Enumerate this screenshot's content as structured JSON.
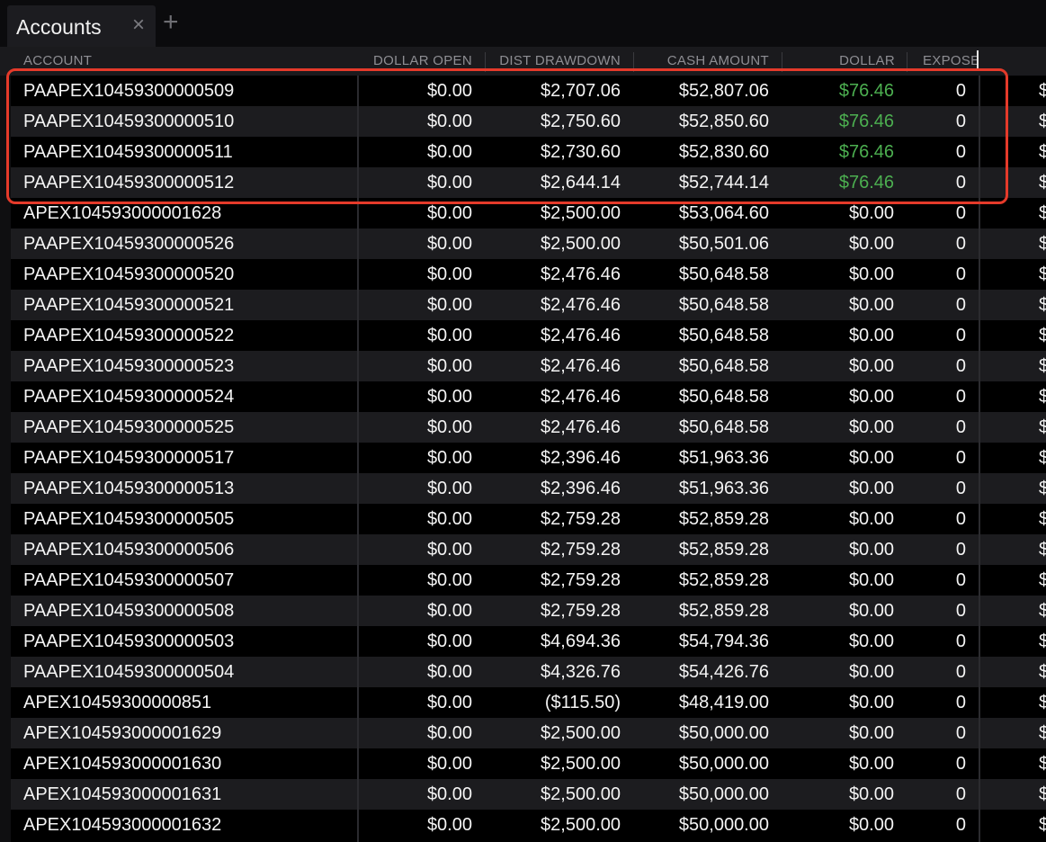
{
  "tab": {
    "title": "Accounts",
    "close": "×",
    "add": "+"
  },
  "columns": [
    "ACCOUNT",
    "DOLLAR OPEN",
    "DIST DRAWDOWN",
    "CASH AMOUNT",
    "DOLLAR",
    "EXPOSE"
  ],
  "rows": [
    {
      "account": "PAAPEX10459300000509",
      "dollar_open": "$0.00",
      "dist_drawdown": "$2,707.06",
      "cash_amount": "$52,807.06",
      "dollar": "$76.46",
      "expose": "0",
      "trail": "$",
      "dollar_status": "positive"
    },
    {
      "account": "PAAPEX10459300000510",
      "dollar_open": "$0.00",
      "dist_drawdown": "$2,750.60",
      "cash_amount": "$52,850.60",
      "dollar": "$76.46",
      "expose": "0",
      "trail": "$",
      "dollar_status": "positive"
    },
    {
      "account": "PAAPEX10459300000511",
      "dollar_open": "$0.00",
      "dist_drawdown": "$2,730.60",
      "cash_amount": "$52,830.60",
      "dollar": "$76.46",
      "expose": "0",
      "trail": "$",
      "dollar_status": "positive"
    },
    {
      "account": "PAAPEX10459300000512",
      "dollar_open": "$0.00",
      "dist_drawdown": "$2,644.14",
      "cash_amount": "$52,744.14",
      "dollar": "$76.46",
      "expose": "0",
      "trail": "$",
      "dollar_status": "positive"
    },
    {
      "account": "APEX104593000001628",
      "dollar_open": "$0.00",
      "dist_drawdown": "$2,500.00",
      "cash_amount": "$53,064.60",
      "dollar": "$0.00",
      "expose": "0",
      "trail": "$",
      "dollar_status": "neutral"
    },
    {
      "account": "PAAPEX10459300000526",
      "dollar_open": "$0.00",
      "dist_drawdown": "$2,500.00",
      "cash_amount": "$50,501.06",
      "dollar": "$0.00",
      "expose": "0",
      "trail": "$",
      "dollar_status": "neutral"
    },
    {
      "account": "PAAPEX10459300000520",
      "dollar_open": "$0.00",
      "dist_drawdown": "$2,476.46",
      "cash_amount": "$50,648.58",
      "dollar": "$0.00",
      "expose": "0",
      "trail": "$",
      "dollar_status": "neutral"
    },
    {
      "account": "PAAPEX10459300000521",
      "dollar_open": "$0.00",
      "dist_drawdown": "$2,476.46",
      "cash_amount": "$50,648.58",
      "dollar": "$0.00",
      "expose": "0",
      "trail": "$",
      "dollar_status": "neutral"
    },
    {
      "account": "PAAPEX10459300000522",
      "dollar_open": "$0.00",
      "dist_drawdown": "$2,476.46",
      "cash_amount": "$50,648.58",
      "dollar": "$0.00",
      "expose": "0",
      "trail": "$",
      "dollar_status": "neutral"
    },
    {
      "account": "PAAPEX10459300000523",
      "dollar_open": "$0.00",
      "dist_drawdown": "$2,476.46",
      "cash_amount": "$50,648.58",
      "dollar": "$0.00",
      "expose": "0",
      "trail": "$",
      "dollar_status": "neutral"
    },
    {
      "account": "PAAPEX10459300000524",
      "dollar_open": "$0.00",
      "dist_drawdown": "$2,476.46",
      "cash_amount": "$50,648.58",
      "dollar": "$0.00",
      "expose": "0",
      "trail": "$",
      "dollar_status": "neutral"
    },
    {
      "account": "PAAPEX10459300000525",
      "dollar_open": "$0.00",
      "dist_drawdown": "$2,476.46",
      "cash_amount": "$50,648.58",
      "dollar": "$0.00",
      "expose": "0",
      "trail": "$",
      "dollar_status": "neutral"
    },
    {
      "account": "PAAPEX10459300000517",
      "dollar_open": "$0.00",
      "dist_drawdown": "$2,396.46",
      "cash_amount": "$51,963.36",
      "dollar": "$0.00",
      "expose": "0",
      "trail": "$",
      "dollar_status": "neutral"
    },
    {
      "account": "PAAPEX10459300000513",
      "dollar_open": "$0.00",
      "dist_drawdown": "$2,396.46",
      "cash_amount": "$51,963.36",
      "dollar": "$0.00",
      "expose": "0",
      "trail": "$",
      "dollar_status": "neutral"
    },
    {
      "account": "PAAPEX10459300000505",
      "dollar_open": "$0.00",
      "dist_drawdown": "$2,759.28",
      "cash_amount": "$52,859.28",
      "dollar": "$0.00",
      "expose": "0",
      "trail": "$",
      "dollar_status": "neutral"
    },
    {
      "account": "PAAPEX10459300000506",
      "dollar_open": "$0.00",
      "dist_drawdown": "$2,759.28",
      "cash_amount": "$52,859.28",
      "dollar": "$0.00",
      "expose": "0",
      "trail": "$",
      "dollar_status": "neutral"
    },
    {
      "account": "PAAPEX10459300000507",
      "dollar_open": "$0.00",
      "dist_drawdown": "$2,759.28",
      "cash_amount": "$52,859.28",
      "dollar": "$0.00",
      "expose": "0",
      "trail": "$",
      "dollar_status": "neutral"
    },
    {
      "account": "PAAPEX10459300000508",
      "dollar_open": "$0.00",
      "dist_drawdown": "$2,759.28",
      "cash_amount": "$52,859.28",
      "dollar": "$0.00",
      "expose": "0",
      "trail": "$",
      "dollar_status": "neutral"
    },
    {
      "account": "PAAPEX10459300000503",
      "dollar_open": "$0.00",
      "dist_drawdown": "$4,694.36",
      "cash_amount": "$54,794.36",
      "dollar": "$0.00",
      "expose": "0",
      "trail": "$",
      "dollar_status": "neutral"
    },
    {
      "account": "PAAPEX10459300000504",
      "dollar_open": "$0.00",
      "dist_drawdown": "$4,326.76",
      "cash_amount": "$54,426.76",
      "dollar": "$0.00",
      "expose": "0",
      "trail": "$",
      "dollar_status": "neutral"
    },
    {
      "account": "APEX10459300000851",
      "dollar_open": "$0.00",
      "dist_drawdown": "($115.50)",
      "cash_amount": "$48,419.00",
      "dollar": "$0.00",
      "expose": "0",
      "trail": "$",
      "dollar_status": "neutral"
    },
    {
      "account": "APEX104593000001629",
      "dollar_open": "$0.00",
      "dist_drawdown": "$2,500.00",
      "cash_amount": "$50,000.00",
      "dollar": "$0.00",
      "expose": "0",
      "trail": "$",
      "dollar_status": "neutral"
    },
    {
      "account": "APEX104593000001630",
      "dollar_open": "$0.00",
      "dist_drawdown": "$2,500.00",
      "cash_amount": "$50,000.00",
      "dollar": "$0.00",
      "expose": "0",
      "trail": "$",
      "dollar_status": "neutral"
    },
    {
      "account": "APEX104593000001631",
      "dollar_open": "$0.00",
      "dist_drawdown": "$2,500.00",
      "cash_amount": "$50,000.00",
      "dollar": "$0.00",
      "expose": "0",
      "trail": "$",
      "dollar_status": "neutral"
    },
    {
      "account": "APEX104593000001632",
      "dollar_open": "$0.00",
      "dist_drawdown": "$2,500.00",
      "cash_amount": "$50,000.00",
      "dollar": "$0.00",
      "expose": "0",
      "trail": "$",
      "dollar_status": "neutral"
    }
  ],
  "colors": {
    "positive": "#4caf50",
    "negative": "#e53935",
    "highlight_border": "#e53a2a",
    "row_alt": "#1c1c1f",
    "header_text": "#8e8e93"
  }
}
